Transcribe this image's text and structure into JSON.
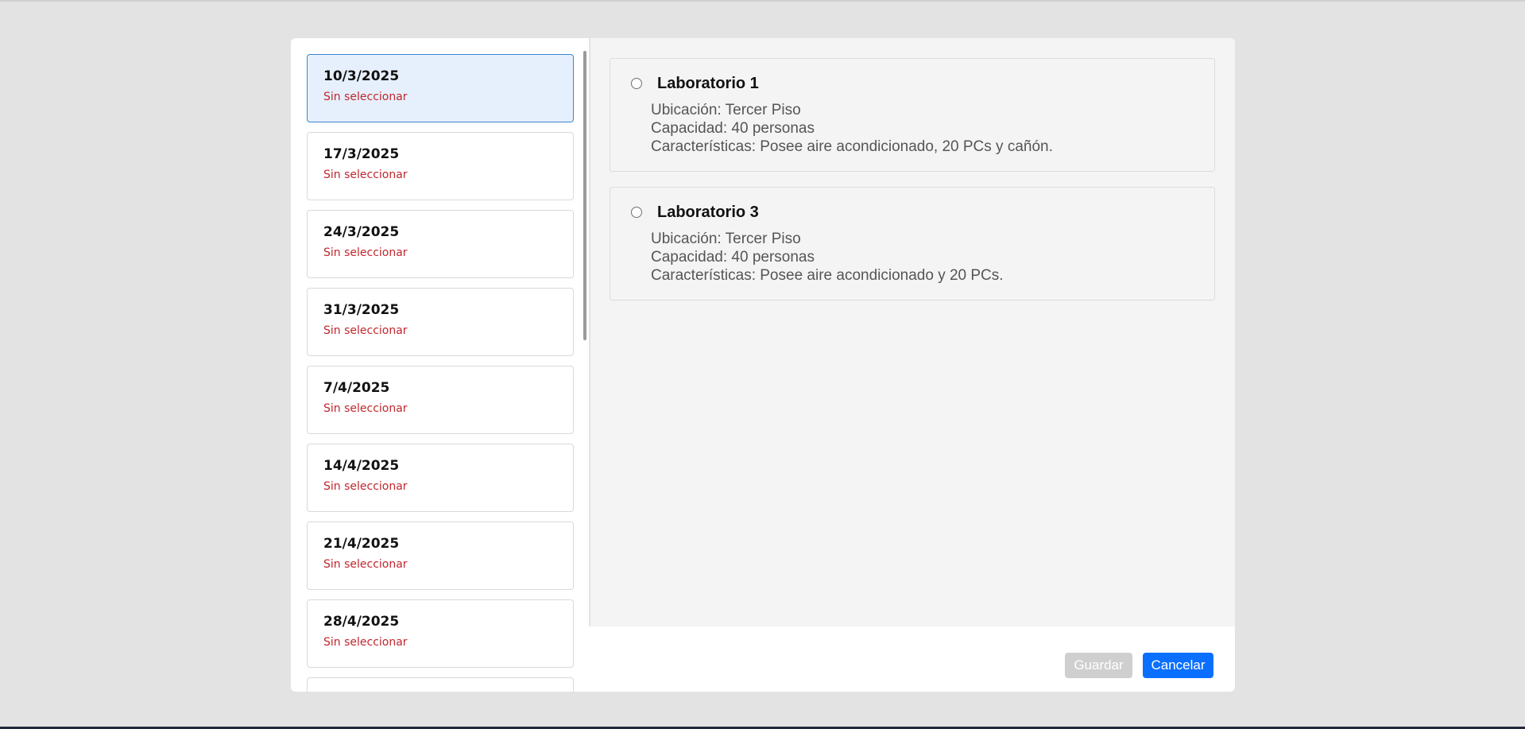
{
  "dates": [
    {
      "date": "10/3/2025",
      "status": "Sin seleccionar",
      "selected": true
    },
    {
      "date": "17/3/2025",
      "status": "Sin seleccionar",
      "selected": false
    },
    {
      "date": "24/3/2025",
      "status": "Sin seleccionar",
      "selected": false
    },
    {
      "date": "31/3/2025",
      "status": "Sin seleccionar",
      "selected": false
    },
    {
      "date": "7/4/2025",
      "status": "Sin seleccionar",
      "selected": false
    },
    {
      "date": "14/4/2025",
      "status": "Sin seleccionar",
      "selected": false
    },
    {
      "date": "21/4/2025",
      "status": "Sin seleccionar",
      "selected": false
    },
    {
      "date": "28/4/2025",
      "status": "Sin seleccionar",
      "selected": false
    }
  ],
  "rooms": [
    {
      "name": "Laboratorio 1",
      "location": "Ubicación: Tercer Piso",
      "capacity": "Capacidad: 40 personas",
      "features": "Características: Posee aire acondicionado, 20 PCs y cañón.",
      "checked": false
    },
    {
      "name": "Laboratorio 3",
      "location": "Ubicación: Tercer Piso",
      "capacity": "Capacidad: 40 personas",
      "features": "Características: Posee aire acondicionado y 20 PCs.",
      "checked": false
    }
  ],
  "footer": {
    "save_label": "Guardar",
    "cancel_label": "Cancelar",
    "save_enabled": false
  },
  "colors": {
    "selected_bg": "#e6f0fc",
    "selected_border": "#3a86d4",
    "status_text": "#c0262d",
    "primary": "#0a6fff",
    "disabled": "#cfcfcf"
  }
}
